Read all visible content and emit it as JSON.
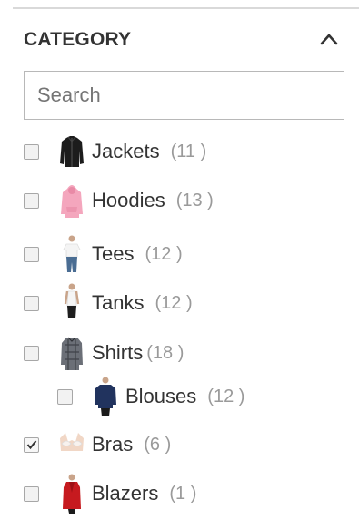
{
  "filter": {
    "title": "CATEGORY",
    "search_placeholder": "Search",
    "items": [
      {
        "label": "Jackets",
        "count": "(11 )",
        "checked": false,
        "icon": "black-jacket"
      },
      {
        "label": "Hoodies",
        "count": "(13 )",
        "checked": false,
        "icon": "pink-hoodie"
      },
      {
        "label": "Tees",
        "count": "(12 )",
        "checked": false,
        "icon": "white-tee"
      },
      {
        "label": "Tanks",
        "count": "(12 )",
        "checked": false,
        "icon": "white-tank"
      },
      {
        "label": "Shirts",
        "count": "(18 )",
        "checked": false,
        "icon": "plaid-shirt"
      },
      {
        "label": "Blouses",
        "count": "(12 )",
        "checked": false,
        "icon": "navy-blouse",
        "nested": true
      },
      {
        "label": "Bras",
        "count": "(6 )",
        "checked": true,
        "icon": "white-bra"
      },
      {
        "label": "Blazers",
        "count": "(1 )",
        "checked": false,
        "icon": "red-blazer"
      }
    ]
  },
  "colors": {
    "text": "#333333",
    "count": "#9a9a9a",
    "border": "#b8b8b8"
  }
}
